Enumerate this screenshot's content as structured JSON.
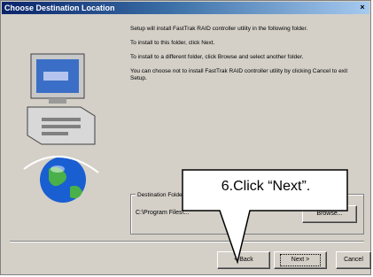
{
  "window": {
    "title": "Choose Destination Location",
    "close_glyph": "×"
  },
  "body": {
    "paragraphs": [
      "Setup will install FastTrak RAID controller utility in the following folder.",
      "To install to this folder, click Next.",
      "To install to a different folder, click Browse and select another folder.",
      "You can choose not to install FastTrak RAID controller utility by clicking Cancel to exit Setup."
    ]
  },
  "destination": {
    "label": "Destination Folder",
    "path": "C:\\Program Files\\..."
  },
  "buttons": {
    "browse": "Browse...",
    "back": "< Back",
    "next": "Next >",
    "cancel": "Cancel"
  },
  "callout": {
    "text": "6.Click “Next”."
  },
  "icons": {
    "art": "computer-globe-icon"
  },
  "colors": {
    "titlebar_start": "#0a246a",
    "titlebar_end": "#a6caf0",
    "dialog_bg": "#d4d0c8"
  }
}
